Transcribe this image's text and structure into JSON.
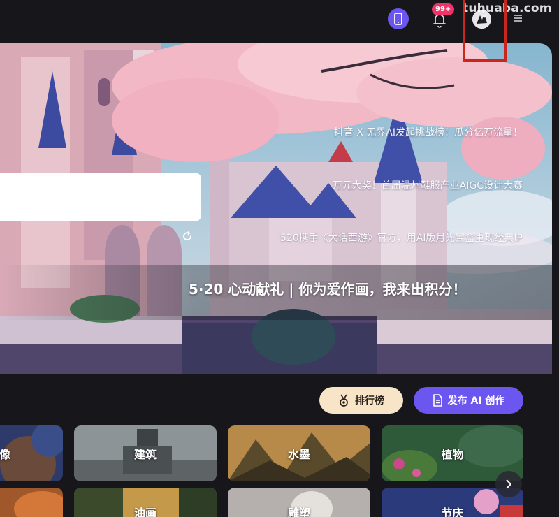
{
  "header": {
    "notification_count": "99+",
    "watermark": "tuhuaba.com"
  },
  "banner": {
    "news": [
      "抖音 X 无界AI发起挑战榜！瓜分亿万流量！",
      "万元大奖！首届温州鞋服产业AIGC设计大赛",
      "520携手《大话西游》官方，用AI版月光宝盒重现经典IP"
    ],
    "headline": "5·20 心动献礼 | 你为爱作画，我来出积分！"
  },
  "actions": {
    "ranking_label": "排行榜",
    "publish_label": "发布 AI 创作"
  },
  "categories": {
    "row1": [
      {
        "label": "像"
      },
      {
        "label": "建筑"
      },
      {
        "label": "水墨"
      },
      {
        "label": "植物"
      }
    ],
    "row2": [
      {
        "label": ""
      },
      {
        "label": "油画"
      },
      {
        "label": "雕塑"
      },
      {
        "label": "节庆"
      }
    ]
  },
  "colors": {
    "accent": "#6c56f0",
    "badge": "#f0346a",
    "ranking_bg": "#f8e4c6",
    "highlight_box": "#c9261f",
    "background": "#17161a"
  }
}
